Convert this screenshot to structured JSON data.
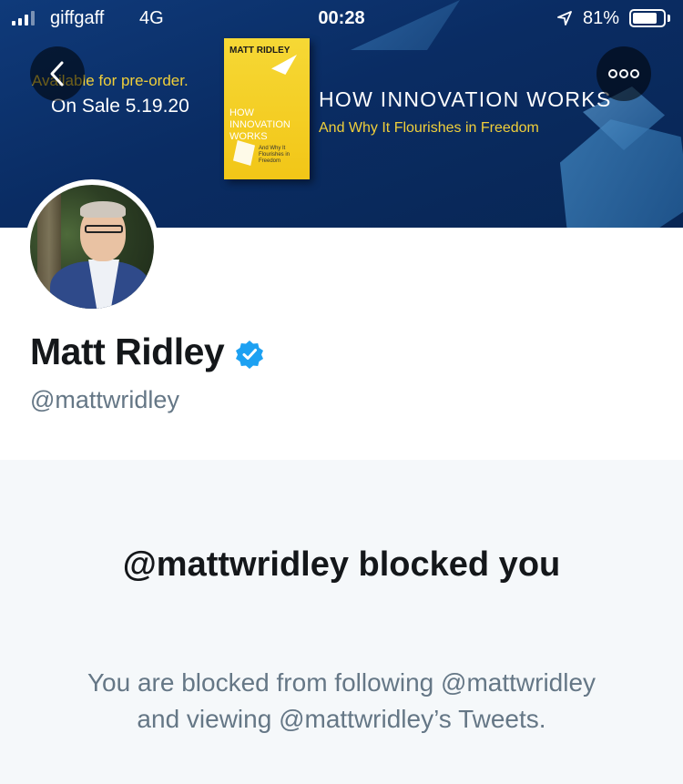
{
  "status_bar": {
    "carrier": "giffgaff",
    "network": "4G",
    "time": "00:28",
    "battery_percent": "81%",
    "battery_level": 0.81,
    "icons": [
      "signal-icon",
      "location-arrow-icon",
      "battery-icon"
    ]
  },
  "banner": {
    "preorder": "Available for pre-order.",
    "on_sale": "On Sale 5.19.20",
    "book_author": "MATT RIDLEY",
    "book_title": "HOW INNOVATION WORKS",
    "book_subtitle": "And Why It Flourishes in Freedom",
    "headline": "HOW INNOVATION WORKS",
    "subheadline": "And Why It Flourishes in Freedom",
    "colors": {
      "background": "#0a2c63",
      "accent_yellow": "#f0cf3a",
      "book_yellow": "#f4cf22"
    }
  },
  "nav": {
    "back_icon": "chevron-left-icon",
    "more_icon": "more-horizontal-icon"
  },
  "profile": {
    "name": "Matt Ridley",
    "handle": "@mattwridley",
    "verified_icon": "verified-badge-icon",
    "verified_color": "#1da1f2"
  },
  "blocked": {
    "title": "@mattwridley blocked you",
    "description": "You are blocked from following @mattwridley and viewing @mattwridley’s Tweets."
  }
}
